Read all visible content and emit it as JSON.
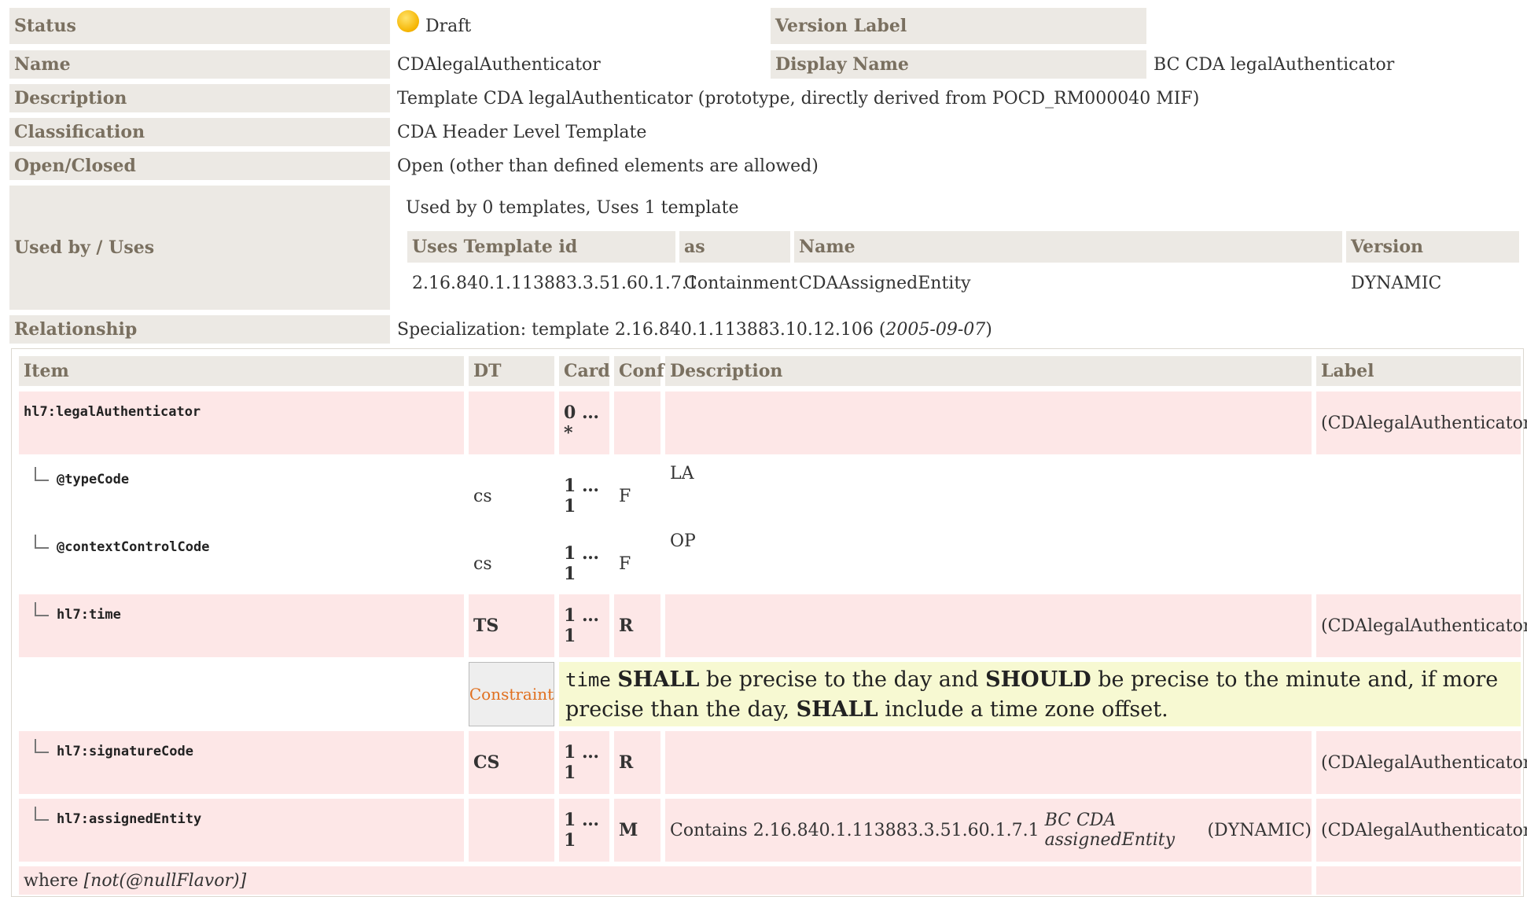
{
  "meta": {
    "status_label": "Status",
    "status_value": "Draft",
    "version_label": "Version Label",
    "name_label": "Name",
    "name_value": "CDAlegalAuthenticator",
    "display_name_label": "Display Name",
    "display_name_value": "BC CDA legalAuthenticator",
    "description_label": "Description",
    "description_value": "Template CDA legalAuthenticator (prototype, directly derived from POCD_RM000040 MIF)",
    "classification_label": "Classification",
    "classification_value": "CDA Header Level Template",
    "openclosed_label": "Open/Closed",
    "openclosed_value": "Open (other than defined elements are allowed)",
    "usedby_label": "Used by / Uses",
    "usedby_summary": "Used by 0 templates, Uses 1 template",
    "relationship_label": "Relationship",
    "relationship_prefix": "Specialization: template 2.16.840.1.113883.10.12.106 (",
    "relationship_date": "2005-09-07",
    "relationship_suffix": ")"
  },
  "uses_table": {
    "headers": [
      "Uses Template id",
      "as",
      "Name",
      "Version"
    ],
    "rows": [
      [
        "2.16.840.1.113883.3.51.60.1.7.1",
        "Containment",
        "CDAAssignedEntity",
        "DYNAMIC"
      ]
    ]
  },
  "items_table": {
    "headers": [
      "Item",
      "DT",
      "Card",
      "Conf",
      "Description",
      "Label"
    ],
    "rows": [
      {
        "item": "hl7:legalAuthenticator",
        "dt": "",
        "card": "0 … *",
        "conf": "",
        "desc": "",
        "label": "(CDAlegalAuthenticator)"
      },
      {
        "item": "@typeCode",
        "dt": "cs",
        "card": "1 … 1",
        "conf": "F",
        "desc": "LA",
        "label": ""
      },
      {
        "item": "@contextControlCode",
        "dt": "cs",
        "card": "1 … 1",
        "conf": "F",
        "desc": "OP",
        "label": ""
      },
      {
        "item": "hl7:time",
        "dt": "TS",
        "card": "1 … 1",
        "conf": "R",
        "desc": "",
        "label": "(CDAlegalAuthenticator)"
      },
      {
        "item": "hl7:signatureCode",
        "dt": "CS",
        "card": "1 … 1",
        "conf": "R",
        "desc": "",
        "label": "(CDAlegalAuthenticator)"
      },
      {
        "item": "hl7:assignedEntity",
        "dt": "",
        "card": "1 … 1",
        "conf": "M",
        "desc_prefix": "Contains 2.16.840.1.113883.3.51.60.1.7.1 ",
        "desc_italic": "BC CDA assignedEntity",
        "desc_suffix": " (DYNAMIC)",
        "label": "(CDAlegalAuthenticator)"
      }
    ],
    "constraint": {
      "label": "Constraint",
      "code": "time",
      "shall1": "SHALL",
      "t1": " be precise to the day and ",
      "should": "SHOULD",
      "t2": " be precise to the minute and, if more precise than the day, ",
      "shall2": "SHALL",
      "t3": " include a time zone offset."
    },
    "where_prefix": "where ",
    "where_expr": "[not(@nullFlavor)]"
  }
}
